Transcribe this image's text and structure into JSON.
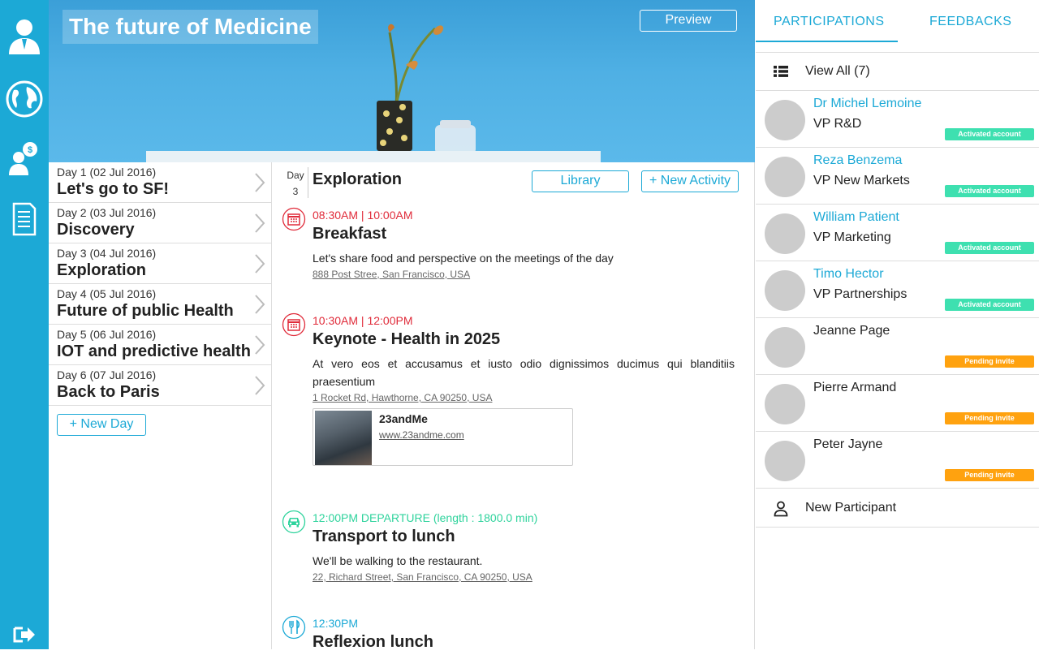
{
  "hero": {
    "title": "The future of Medicine",
    "preview_label": "Preview"
  },
  "colors": {
    "accent": "#1ca9d6",
    "meal": "#e02b3a",
    "transport": "#2ed39c",
    "food": "#1ca9d6",
    "activated": "#3ee0b0",
    "pending": "#ffa20f"
  },
  "rail": {
    "icons": [
      "user-icon",
      "globe-icon",
      "user-idea-icon",
      "document-icon",
      "logout-icon"
    ]
  },
  "days": [
    {
      "date": "Day 1 (02 Jul 2016)",
      "title": "Let's go to SF!"
    },
    {
      "date": "Day 2 (03 Jul 2016)",
      "title": "Discovery"
    },
    {
      "date": "Day 3 (04 Jul 2016)",
      "title": "Exploration"
    },
    {
      "date": "Day 4 (05 Jul 2016)",
      "title": "Future of public Health"
    },
    {
      "date": "Day 5 (06 Jul 2016)",
      "title": "IOT and predictive health"
    },
    {
      "date": "Day 6 (07 Jul 2016)",
      "title": "Back to Paris"
    }
  ],
  "new_day_label": "+ New Day",
  "main": {
    "day_label": "Day",
    "day_number": "3",
    "title": "Exploration",
    "library_label": "Library",
    "new_activity_label": "+ New Activity",
    "activities": [
      {
        "time": "08:30AM | 10:00AM",
        "title": "Breakfast",
        "description": "Let's share food and perspective on the meetings of the day",
        "address": "888 Post Stree, San Francisco, USA"
      },
      {
        "time": "10:30AM | 12:00PM",
        "title": "Keynote - Health in 2025",
        "description": "At vero eos et accusamus et iusto odio dignissimos ducimus qui blanditiis praesentium",
        "address": "1 Rocket Rd, Hawthorne, CA 90250, USA",
        "card": {
          "name": "23andMe",
          "url": "www.23andme.com"
        }
      },
      {
        "time": "12:00PM DEPARTURE (length : 1800.0 min)",
        "title": "Transport to lunch",
        "description": "We'll be walking to the restaurant.",
        "address": "22, Richard Street, San Francisco, CA 90250, USA"
      },
      {
        "time": "12:30PM",
        "title": "Reflexion lunch"
      }
    ]
  },
  "right": {
    "tabs": [
      "PARTICIPATIONS",
      "FEEDBACKS"
    ],
    "view_all_label": "View All (7)",
    "participants": [
      {
        "name": "Dr Michel Lemoine",
        "role": "VP R&D",
        "status": "Activated account"
      },
      {
        "name": "Reza Benzema",
        "role": "VP New Markets",
        "status": "Activated account"
      },
      {
        "name": "William Patient",
        "role": "VP Marketing",
        "status": "Activated account"
      },
      {
        "name": "Timo Hector",
        "role": "VP Partnerships",
        "status": "Activated account"
      },
      {
        "name": "Jeanne Page",
        "role": "",
        "status": "Pending invite"
      },
      {
        "name": "Pierre Armand",
        "role": "",
        "status": "Pending invite"
      },
      {
        "name": "Peter Jayne",
        "role": "",
        "status": "Pending invite"
      }
    ],
    "new_participant_label": "New Participant"
  }
}
